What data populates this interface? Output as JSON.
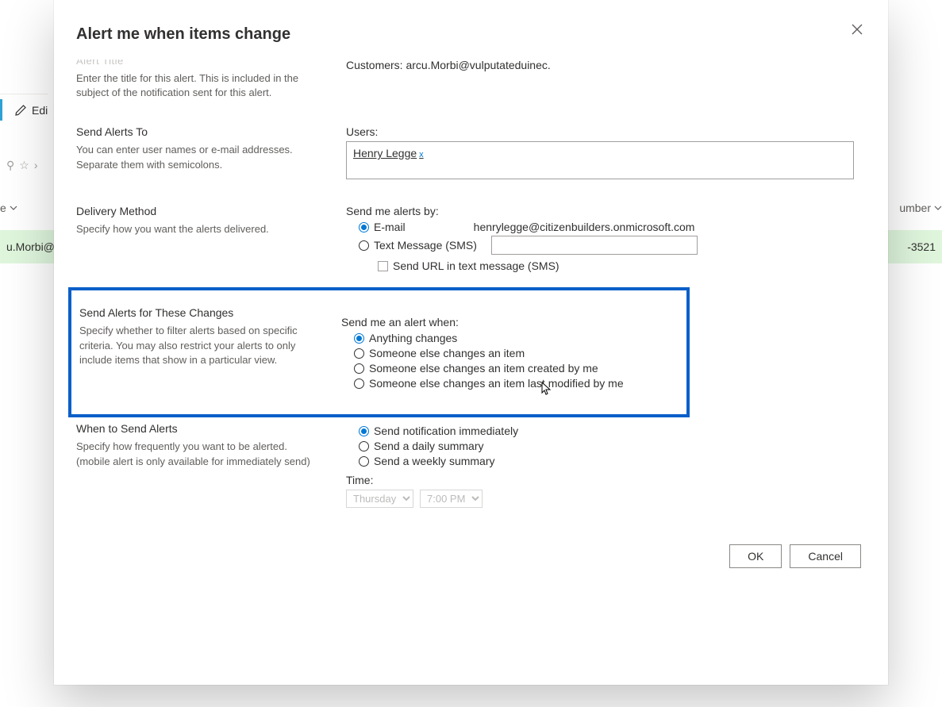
{
  "background": {
    "edit_label": "Edi",
    "dropdown_partial": "e",
    "row_email_partial": "u.Morbi@",
    "col_number_partial": "umber",
    "row_phone_partial": "-3521"
  },
  "modal": {
    "title": "Alert me when items change",
    "sectionTitlePartial": "Alert Title",
    "sections": {
      "alert_title": {
        "heading": "Alert Title",
        "description": "Enter the title for this alert. This is included in the subject of the notification sent for this alert.",
        "value": "Customers: arcu.Morbi@vulputateduinec."
      },
      "send_to": {
        "heading": "Send Alerts To",
        "description": "You can enter user names or e-mail addresses. Separate them with semicolons.",
        "users_label": "Users:",
        "user_chip": "Henry Legge",
        "remove_chip": "x"
      },
      "delivery": {
        "heading": "Delivery Method",
        "description": "Specify how you want the alerts delivered.",
        "send_by_label": "Send me alerts by:",
        "email_label": "E-mail",
        "email_value": "henrylegge@citizenbuilders.onmicrosoft.com",
        "sms_label": "Text Message (SMS)",
        "send_url_label": "Send URL in text message (SMS)"
      },
      "changes": {
        "heading": "Send Alerts for These Changes",
        "description": "Specify whether to filter alerts based on specific criteria. You may also restrict your alerts to only include items that show in a particular view.",
        "send_when_label": "Send me an alert when:",
        "opt1": "Anything changes",
        "opt2": "Someone else changes an item",
        "opt3": "Someone else changes an item created by me",
        "opt4": "Someone else changes an item last modified by me"
      },
      "when": {
        "heading": "When to Send Alerts",
        "description": "Specify how frequently you want to be alerted. (mobile alert is only available for immediately send)",
        "opt1": "Send notification immediately",
        "opt2": "Send a daily summary",
        "opt3": "Send a weekly summary",
        "time_label": "Time:",
        "day_value": "Thursday",
        "hour_value": "7:00 PM"
      }
    },
    "buttons": {
      "ok": "OK",
      "cancel": "Cancel"
    }
  }
}
